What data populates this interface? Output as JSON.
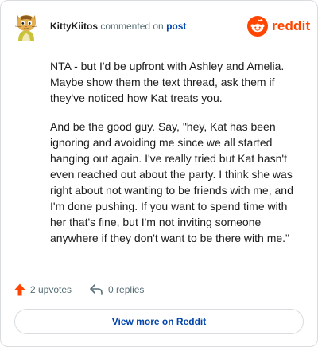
{
  "header": {
    "username": "KittyKiitos",
    "commented_text": "commented on",
    "post_link": "post"
  },
  "brand": {
    "name": "reddit",
    "icon": "reddit-logo-icon",
    "color": "#ff4500"
  },
  "comment": {
    "paragraphs": [
      "NTA - but I'd be upfront with Ashley and Amelia. Maybe show them the text thread, ask them if they've noticed how Kat treats you.",
      "And be the good guy. Say, \"hey, Kat has been ignoring and avoiding me since we all started hanging out again. I've really tried but Kat hasn't even reached out about the party. I think she was right about not wanting to be friends with me, and I'm done pushing. If you want to spend time with her that's fine, but I'm not inviting someone anywhere if they don't want to be there with me.\""
    ]
  },
  "actions": {
    "upvotes_label": "2 upvotes",
    "upvote_icon": "upvote-arrow-icon",
    "replies_label": "0 replies",
    "reply_icon": "reply-arrow-icon"
  },
  "footer": {
    "view_more_label": "View more on Reddit"
  },
  "colors": {
    "accent": "#ff4500",
    "link": "#0045ac",
    "muted": "#576f76",
    "border": "#d9dde0"
  }
}
